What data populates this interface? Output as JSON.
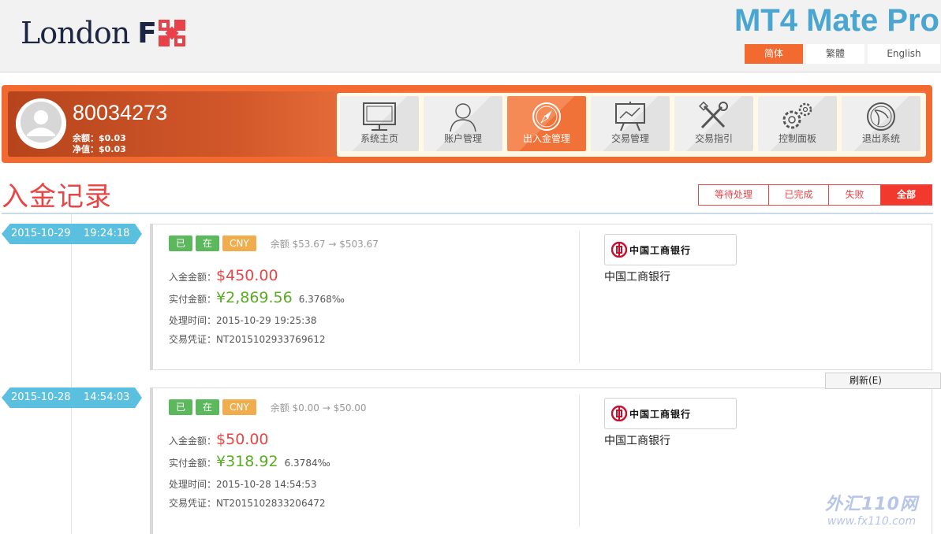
{
  "header": {
    "logo_text": "London",
    "logo_mark": "F",
    "app_title": "MT4 Mate Pro",
    "languages": [
      {
        "label": "简体",
        "active": true
      },
      {
        "label": "繁體",
        "active": false
      },
      {
        "label": "English",
        "active": false
      }
    ]
  },
  "account": {
    "number": "80034273",
    "balance_label": "余额：",
    "balance_value": "$0.03",
    "equity_label": "净值：",
    "equity_value": "$0.03"
  },
  "nav": [
    {
      "label": "系统主页",
      "icon": "monitor-icon",
      "active": false
    },
    {
      "label": "账户管理",
      "icon": "user-icon",
      "active": false
    },
    {
      "label": "出入金管理",
      "icon": "compass-icon",
      "active": true
    },
    {
      "label": "交易管理",
      "icon": "chart-board-icon",
      "active": false
    },
    {
      "label": "交易指引",
      "icon": "tools-icon",
      "active": false
    },
    {
      "label": "控制面板",
      "icon": "gears-icon",
      "active": false
    },
    {
      "label": "退出系统",
      "icon": "basketball-icon",
      "active": false
    }
  ],
  "page_title": "入金记录",
  "filters": [
    {
      "label": "等待处理",
      "active": false
    },
    {
      "label": "已完成",
      "active": false
    },
    {
      "label": "失败",
      "active": false
    },
    {
      "label": "全部",
      "active": true
    }
  ],
  "records": [
    {
      "date": "2015-10-29",
      "time": "19:24:18",
      "badges": [
        "已完成",
        "在线支付",
        "CNY"
      ],
      "balance_change": "余额 $53.67 → $503.67",
      "deposit_label": "入金金额：",
      "deposit_amount": "$450.00",
      "paid_label": "实付金额：",
      "paid_amount": "¥2,869.56",
      "rate": "6.3768‰",
      "processed_label": "处理时间：",
      "processed_time": "2015-10-29 19:25:38",
      "voucher_label": "交易凭证：",
      "voucher": "NT2015102933769612",
      "bank_logo_text": "中国工商银行",
      "bank_name": "中国工商银行"
    },
    {
      "date": "2015-10-28",
      "time": "14:54:03",
      "badges": [
        "已完成",
        "在线支付",
        "CNY"
      ],
      "balance_change": "余额 $0.00 → $50.00",
      "deposit_label": "入金金额：",
      "deposit_amount": "$50.00",
      "paid_label": "实付金额：",
      "paid_amount": "¥318.92",
      "rate": "6.3784‰",
      "processed_label": "处理时间：",
      "processed_time": "2015-10-28 14:54:53",
      "voucher_label": "交易凭证：",
      "voucher": "NT2015102833206472",
      "bank_logo_text": "中国工商银行",
      "bank_name": "中国工商银行"
    }
  ],
  "context_menu": {
    "refresh_label": "刷新(E)"
  },
  "watermark": {
    "line1": "外汇110网",
    "line2": "www.fx110.com"
  },
  "colors": {
    "accent": "#f26a2f",
    "title_red": "#e94545",
    "blue": "#4aa6d1",
    "green": "#5cb85c",
    "orange": "#f0ad4e"
  }
}
